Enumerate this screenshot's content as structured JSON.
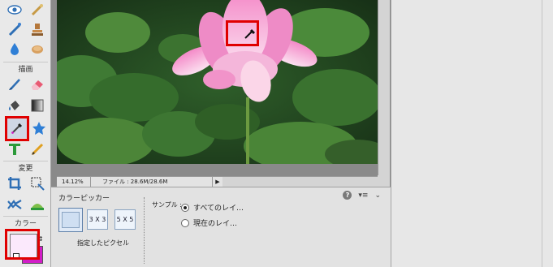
{
  "toolbox": {
    "section_draw": "描画",
    "section_modify": "変更",
    "section_color": "カラー",
    "tools": [
      "eye-icon",
      "magic-brush-icon",
      "clone-stamp-icon",
      "sponge-icon",
      "blur-drop-icon",
      "smudge-icon",
      "brush-icon",
      "eraser-icon",
      "paint-bucket-icon",
      "gradient-icon",
      "eyedropper-icon",
      "custom-shape-icon",
      "type-icon",
      "pencil-icon",
      "crop-icon",
      "recompose-icon",
      "content-move-icon",
      "straighten-icon"
    ],
    "selected_tool": "eyedropper-icon",
    "foreground_color": "#fbe9fc",
    "background_color": "#d21ec8"
  },
  "status": {
    "zoom": "14.12%",
    "file_info": "ファイル : 28.6M/28.6M",
    "arrow": "▶"
  },
  "options": {
    "title": "カラーピッカー",
    "btn_3x3": "3 X 3",
    "btn_5x5": "5 X 5",
    "point_label": "指定したピクセル",
    "sample_label": "サンプル :",
    "radio_all": "すべてのレイ…",
    "radio_current": "現在のレイ…",
    "help": "?",
    "menu": "▾≡",
    "collapse": "⌄"
  },
  "colors": {
    "highlight": "#e00000"
  }
}
